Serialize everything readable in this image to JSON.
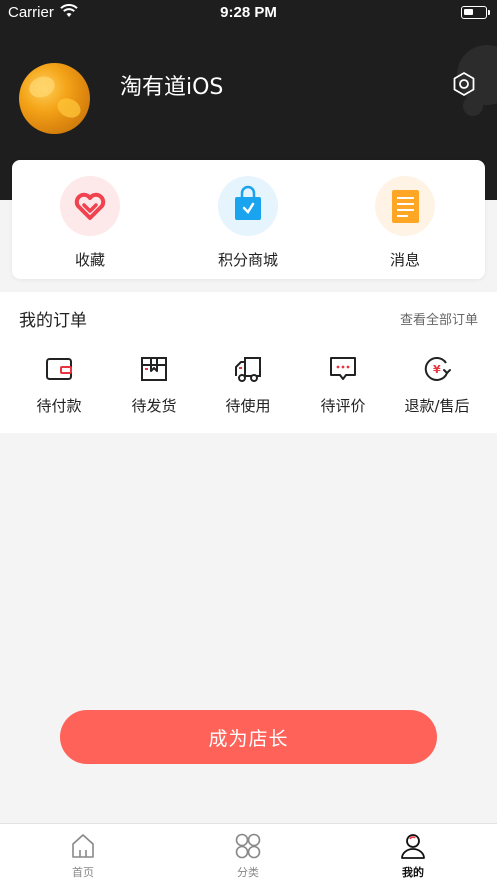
{
  "status_bar": {
    "carrier": "Carrier",
    "time": "9:28 PM"
  },
  "profile": {
    "username": "淘有道iOS"
  },
  "quick": [
    {
      "label": "收藏",
      "icon": "heart-icon"
    },
    {
      "label": "积分商城",
      "icon": "shopping-bag-icon"
    },
    {
      "label": "消息",
      "icon": "message-note-icon"
    }
  ],
  "orders": {
    "title": "我的订单",
    "view_all": "查看全部订单",
    "items": [
      {
        "label": "待付款",
        "icon": "wallet-icon"
      },
      {
        "label": "待发货",
        "icon": "box-icon"
      },
      {
        "label": "待使用",
        "icon": "truck-icon"
      },
      {
        "label": "待评价",
        "icon": "comment-icon"
      },
      {
        "label": "退款/售后",
        "icon": "refund-icon"
      }
    ]
  },
  "cta": {
    "label": "成为店长"
  },
  "tabbar": {
    "items": [
      {
        "label": "首页",
        "icon": "home-icon"
      },
      {
        "label": "分类",
        "icon": "category-icon"
      },
      {
        "label": "我的",
        "icon": "profile-icon"
      }
    ]
  },
  "colors": {
    "header_bg": "#1e1e1e",
    "accent_red": "#ff6259",
    "page_bg": "#f4f4f4"
  }
}
